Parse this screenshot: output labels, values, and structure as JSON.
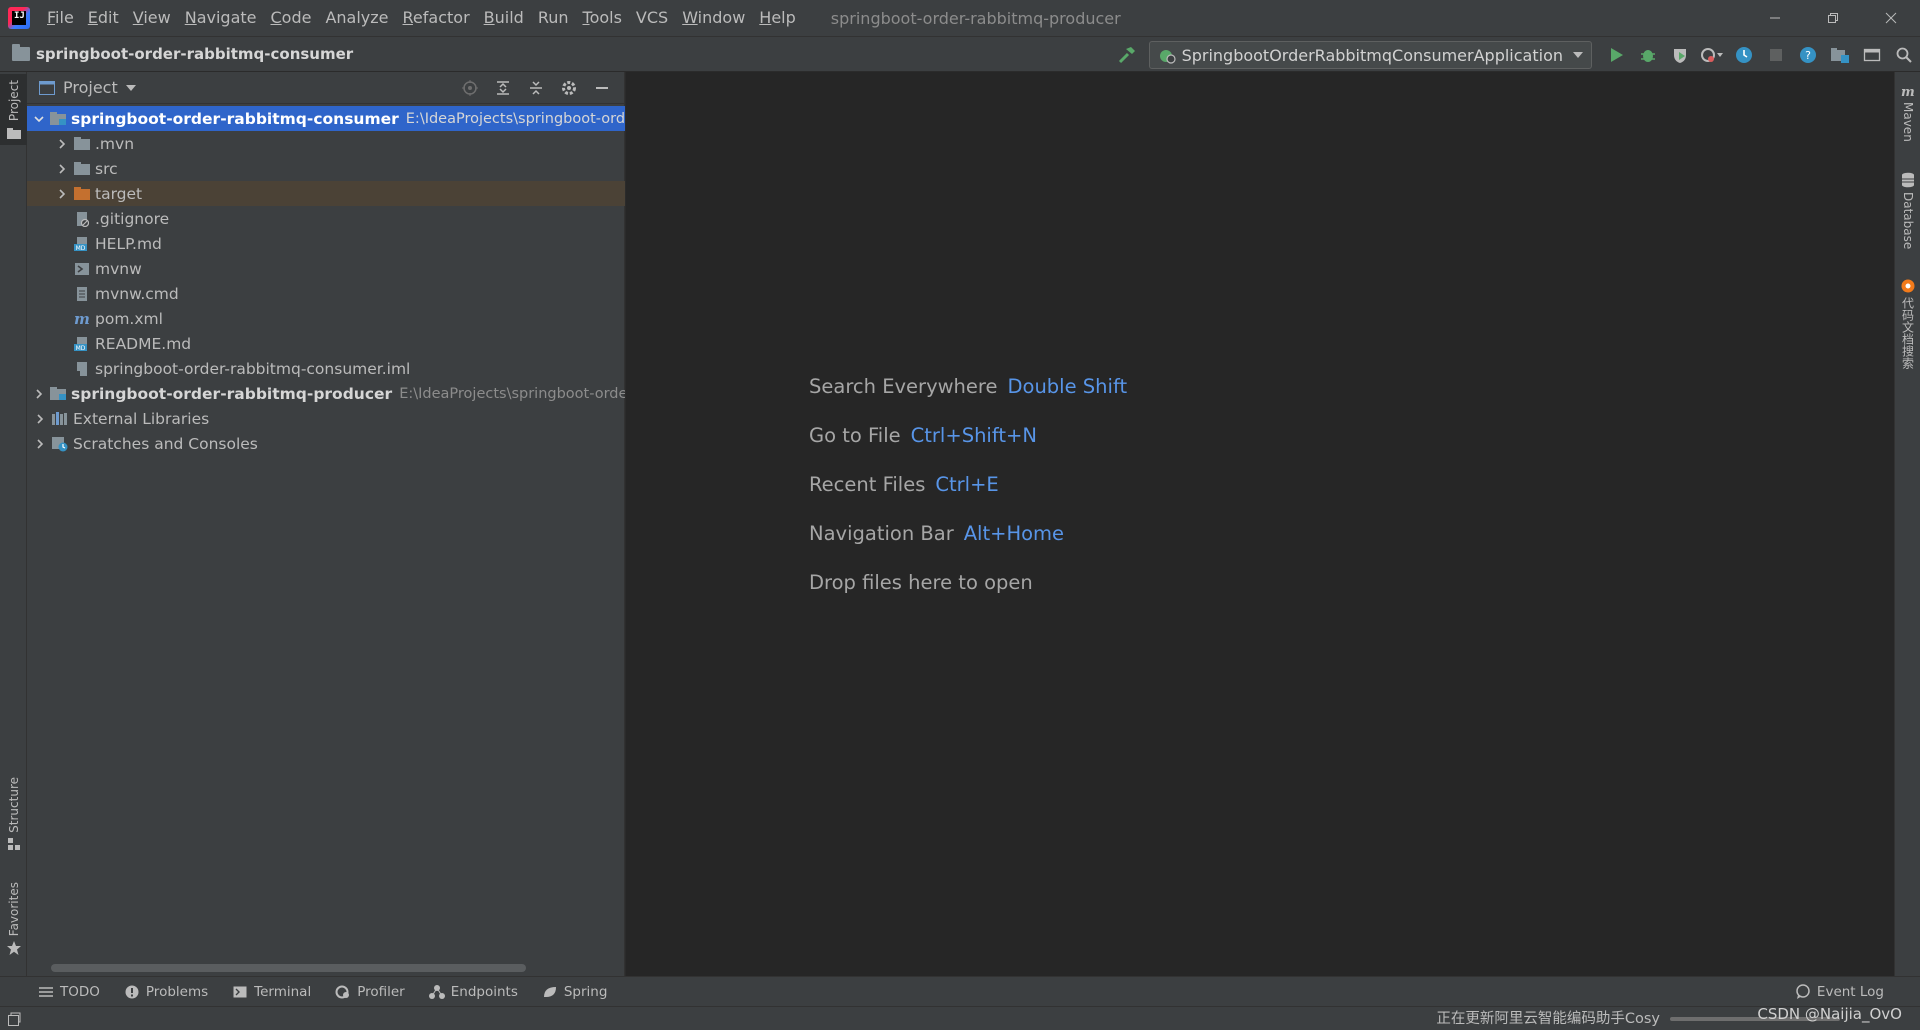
{
  "app": {
    "logo_text": "IJ",
    "window_title": "springboot-order-rabbitmq-producer"
  },
  "menu": [
    {
      "label": "File",
      "mnemonic": "F",
      "rest": "ile"
    },
    {
      "label": "Edit",
      "mnemonic": "E",
      "rest": "dit"
    },
    {
      "label": "View",
      "mnemonic": "V",
      "rest": "iew"
    },
    {
      "label": "Navigate",
      "mnemonic": "N",
      "rest": "avigate"
    },
    {
      "label": "Code",
      "mnemonic": "C",
      "rest": "ode"
    },
    {
      "label": "Analyze",
      "mnemonic": "",
      "rest": "Analyze"
    },
    {
      "label": "Refactor",
      "mnemonic": "R",
      "rest": "efactor"
    },
    {
      "label": "Build",
      "mnemonic": "B",
      "rest": "uild"
    },
    {
      "label": "Run",
      "mnemonic": "",
      "rest": "Run"
    },
    {
      "label": "Tools",
      "mnemonic": "T",
      "rest": "ools"
    },
    {
      "label": "VCS",
      "mnemonic": "",
      "rest": "VCS"
    },
    {
      "label": "Window",
      "mnemonic": "W",
      "rest": "indow"
    },
    {
      "label": "Help",
      "mnemonic": "H",
      "rest": "elp"
    }
  ],
  "navbar": {
    "project": "springboot-order-rabbitmq-consumer",
    "run_config": "SpringbootOrderRabbitmqConsumerApplication"
  },
  "left_strip": {
    "project_tab": "Project",
    "structure_tab": "Structure",
    "favorites_tab": "Favorites"
  },
  "project_panel": {
    "title": "Project",
    "tree": {
      "consumer_name": "springboot-order-rabbitmq-consumer",
      "consumer_path": "E:\\IdeaProjects\\springboot-order-",
      "mvn": ".mvn",
      "src": "src",
      "target": "target",
      "gitignore": ".gitignore",
      "help": "HELP.md",
      "mvnw": "mvnw",
      "mvnw_cmd": "mvnw.cmd",
      "pom": "pom.xml",
      "readme": "README.md",
      "iml": "springboot-order-rabbitmq-consumer.iml",
      "producer_name": "springboot-order-rabbitmq-producer",
      "producer_path": "E:\\IdeaProjects\\springboot-order-r",
      "external": "External Libraries",
      "scratches": "Scratches and Consoles"
    }
  },
  "editor_hints": [
    {
      "label": "Search Everywhere",
      "key": "Double Shift"
    },
    {
      "label": "Go to File",
      "key": "Ctrl+Shift+N"
    },
    {
      "label": "Recent Files",
      "key": "Ctrl+E"
    },
    {
      "label": "Navigation Bar",
      "key": "Alt+Home"
    },
    {
      "label": "Drop files here to open",
      "key": ""
    }
  ],
  "right_strip": {
    "maven_tab": "Maven",
    "database_tab": "Database",
    "cosy_tab": "代码文档搜索"
  },
  "bottom_bar": {
    "todo": "TODO",
    "problems": "Problems",
    "terminal": "Terminal",
    "profiler": "Profiler",
    "endpoints": "Endpoints",
    "spring": "Spring",
    "event_log": "Event Log"
  },
  "status": {
    "text": "正在更新阿里云智能编码助手Cosy",
    "watermark": "CSDN @Naijia_OvO"
  },
  "colors": {
    "accent": "#2f65ca",
    "shortcut": "#5895e8",
    "run_green": "#59a869",
    "target_folder": "#c4702f"
  }
}
